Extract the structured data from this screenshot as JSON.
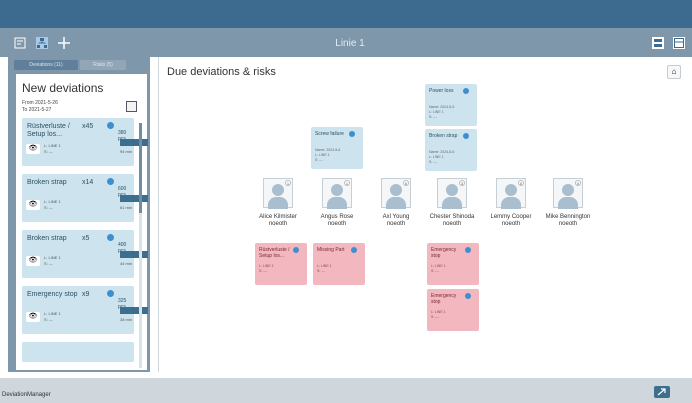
{
  "window": {
    "title": "Linie 1"
  },
  "tabs": [
    {
      "label": "Deviations (11)"
    },
    {
      "label": "Risks (5)"
    }
  ],
  "new_deviations": {
    "title": "New deviations",
    "from_label": "From",
    "from_value": "2021-5-26",
    "to_label": "To",
    "to_value": "2021-5-27",
    "cards": [
      {
        "title": "Rüstverluste / Setup los...",
        "count": "x45",
        "pcs": "380 pcs",
        "time": "94 min",
        "meta1": "L: LINE 1",
        "meta2": "S: ---"
      },
      {
        "title": "Broken strap",
        "count": "x14",
        "pcs": "600 pcs",
        "time": "61 min",
        "meta1": "L: LINE 1",
        "meta2": "S: ---"
      },
      {
        "title": "Broken strap",
        "count": "x5",
        "pcs": "400 pcs",
        "time": "44 min",
        "meta1": "L: LINE 1",
        "meta2": "S: ---"
      },
      {
        "title": "Emergency stop",
        "count": "x9",
        "pcs": "325 pcs",
        "time": "38 min",
        "meta1": "L: LINE 1",
        "meta2": "S: ---"
      }
    ]
  },
  "main": {
    "title": "Due deviations & risks",
    "people": [
      {
        "name": "Alice Kilmister",
        "role": "noeoth",
        "badge": "1"
      },
      {
        "name": "Angus Rose",
        "role": "noeoth",
        "badge": "1"
      },
      {
        "name": "Axl Young",
        "role": "noeoth",
        "badge": "0"
      },
      {
        "name": "Chester Shinoda",
        "role": "noeoth",
        "badge": "3"
      },
      {
        "name": "Lemmy Cooper",
        "role": "noeoth",
        "badge": "0"
      },
      {
        "name": "Mike Bennington",
        "role": "noeoth",
        "badge": "0"
      }
    ],
    "risk_cards": [
      {
        "title": "Power loss",
        "meta1": "Name: 2024-5-6",
        "meta2": "L: LINE 1",
        "meta3": "S: ---"
      },
      {
        "title": "Broken strap",
        "meta1": "Name: 2024-5-6",
        "meta2": "L: LINE 1",
        "meta3": "S: ---"
      },
      {
        "title": "Screw failure",
        "meta1": "Name: 2024-5-6",
        "meta2": "L: LINE 1",
        "meta3": "S: ---"
      }
    ],
    "deviation_cards": [
      {
        "title": "Rüstverluste / Setup los...",
        "meta1": "L: LINE 1",
        "meta2": "S: ---"
      },
      {
        "title": "Missing Part",
        "meta1": "L: LINE 1",
        "meta2": "S: ---"
      },
      {
        "title": "Emergency stop",
        "meta1": "L: LINE 1",
        "meta2": "S: ---"
      },
      {
        "title": "Emergency stop",
        "meta1": "L: LINE 1",
        "meta2": "S: ---"
      }
    ]
  },
  "footer": {
    "label": "DeviationManager"
  },
  "colors": {
    "topbar": "#3d6b8f",
    "toolbar": "#7f97ab",
    "card_blue": "#cde4ee",
    "card_red": "#f2b7bf",
    "accent": "#3e8fd0"
  },
  "icons": {
    "toolbar_left": [
      "document-icon",
      "org-chart-icon",
      "plus-icon"
    ],
    "toolbar_right": [
      "view-grid-icon",
      "view-list-icon"
    ],
    "footer_button": "expand-icon"
  }
}
